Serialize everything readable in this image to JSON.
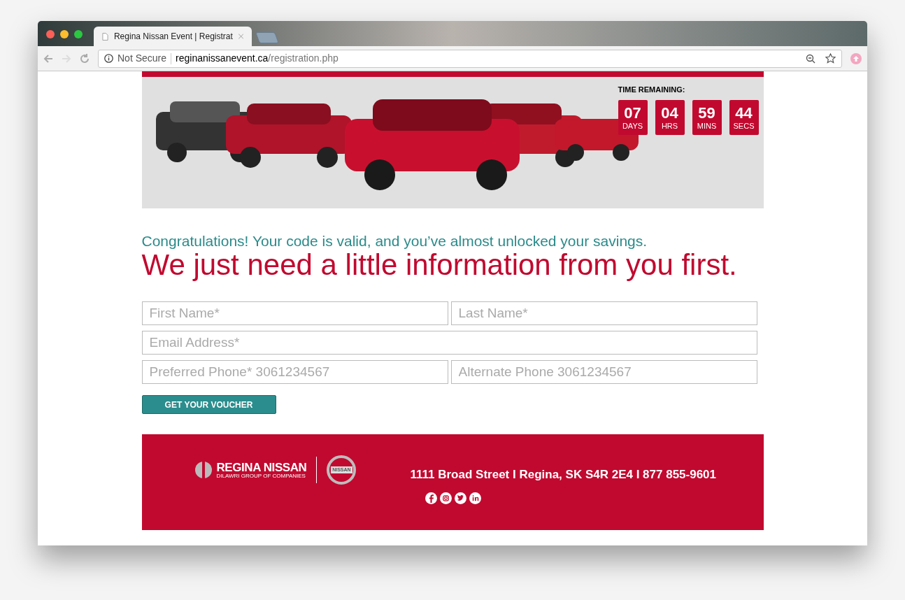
{
  "browser": {
    "tab_title": "Regina Nissan Event | Registrat",
    "address_security": "Not Secure",
    "address_host": "reginanissanevent.ca",
    "address_path": "/registration.php"
  },
  "countdown": {
    "label": "TIME REMAINING:",
    "units": [
      {
        "value": "07",
        "unit": "DAYS"
      },
      {
        "value": "04",
        "unit": "HRS"
      },
      {
        "value": "59",
        "unit": "MINS"
      },
      {
        "value": "44",
        "unit": "SECS"
      }
    ]
  },
  "intro": "Congratulations! Your code is valid, and you’ve almost unlocked your savings.",
  "heading": "We just need a little information from you first.",
  "form_rows": [
    [
      {
        "placeholder": "First Name*"
      },
      {
        "placeholder": "Last Name*"
      }
    ],
    [
      {
        "placeholder": "Email Address*"
      }
    ],
    [
      {
        "placeholder": "Preferred Phone* 3061234567"
      },
      {
        "placeholder": "Alternate Phone 3061234567"
      }
    ]
  ],
  "submit": "GET YOUR VOUCHER",
  "footer": {
    "brand": "REGINA NISSAN",
    "brand_sub": "DILAWRI GROUP OF COMPANIES",
    "badge": "NISSAN",
    "address": "1111 Broad Street I Regina, SK S4R 2E4 I 877 855-9601",
    "social": [
      {
        "kind": "facebook"
      },
      {
        "kind": "instagram"
      },
      {
        "kind": "twitter"
      },
      {
        "kind": "linkedin"
      }
    ]
  }
}
